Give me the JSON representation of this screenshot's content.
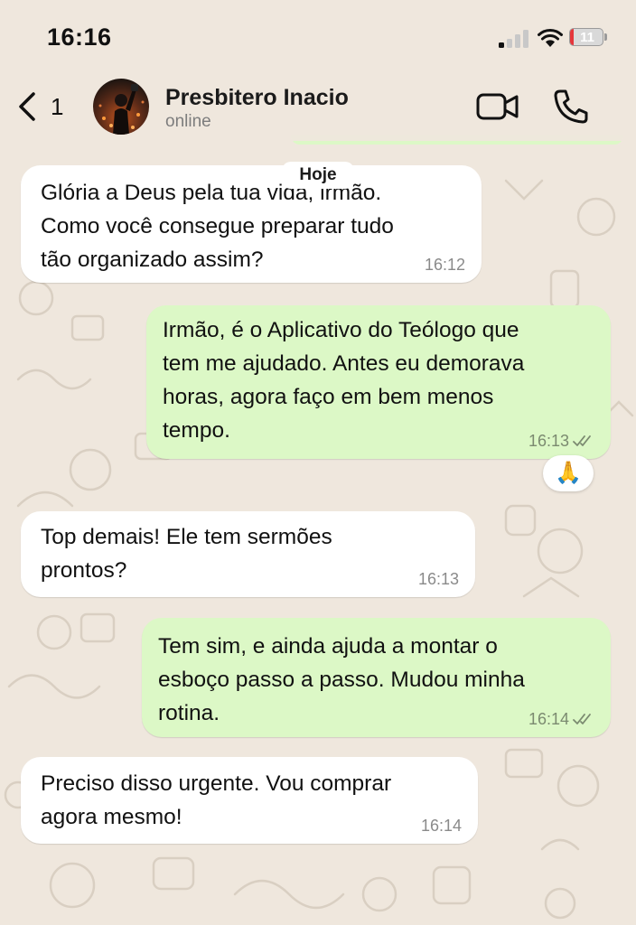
{
  "status_bar": {
    "time": "16:16",
    "battery_level": "11",
    "battery_fraction": 0.11
  },
  "header": {
    "back_count": "1",
    "contact_name": "Presbitero Inacio",
    "contact_status": "online",
    "icons": [
      "chevron-left-icon",
      "video-camera-icon",
      "phone-icon"
    ]
  },
  "date_divider": "Hoje",
  "messages": [
    {
      "direction": "incoming",
      "text": "Glória a Deus pela tua vida, irmão.\nComo você consegue preparar tudo\ntão organizado assim?",
      "time": "16:12"
    },
    {
      "direction": "outgoing",
      "text": "Irmão, é o Aplicativo do Teólogo que\ntem me ajudado. Antes eu demorava\nhoras, agora faço em bem menos\ntempo.",
      "time": "16:13",
      "status": "read",
      "reaction": "🙏"
    },
    {
      "direction": "incoming",
      "text": "Top demais! Ele tem sermões\nprontos?",
      "time": "16:13"
    },
    {
      "direction": "outgoing",
      "text": "Tem sim, e ainda ajuda a montar o\nesboço passo a passo. Mudou minha\nrotina.",
      "time": "16:14",
      "status": "read"
    },
    {
      "direction": "incoming",
      "text": "Preciso disso urgente. Vou comprar\nagora mesmo!",
      "time": "16:14"
    }
  ],
  "colors": {
    "background": "#efe7dd",
    "incoming_bubble": "#ffffff",
    "outgoing_bubble": "#dcf8c6",
    "battery_low": "#e5363b"
  }
}
